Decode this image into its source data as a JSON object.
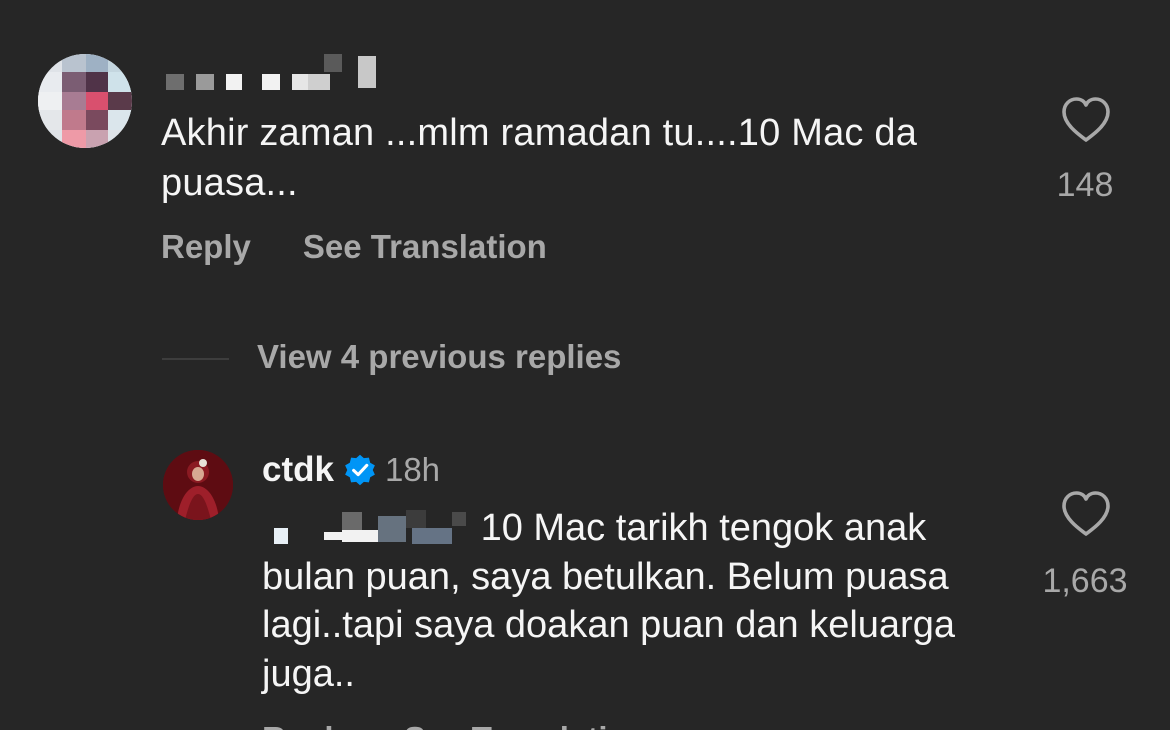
{
  "comment": {
    "text": "Akhir zaman ...mlm ramadan tu....10 Mac da puasa...",
    "likes": "148",
    "reply_label": "Reply",
    "translate_label": "See Translation"
  },
  "thread": {
    "view_replies_label": "View 4 previous replies"
  },
  "reply": {
    "username": "ctdk",
    "time": "18h",
    "text_after_mention": "10 Mac tarikh tengok anak bulan puan, saya betulkan. Belum puasa lagi..tapi saya doakan puan dan keluarga juga..",
    "likes": "1,663",
    "reply_label": "Reply",
    "translate_label": "See Translation"
  },
  "colors": {
    "background": "#262626",
    "primary_text": "#f5f5f5",
    "secondary_text": "#a8a8a8",
    "verified_blue": "#0095f6"
  },
  "icons": {
    "like": "heart-outline-icon",
    "verified": "verified-badge-icon"
  }
}
